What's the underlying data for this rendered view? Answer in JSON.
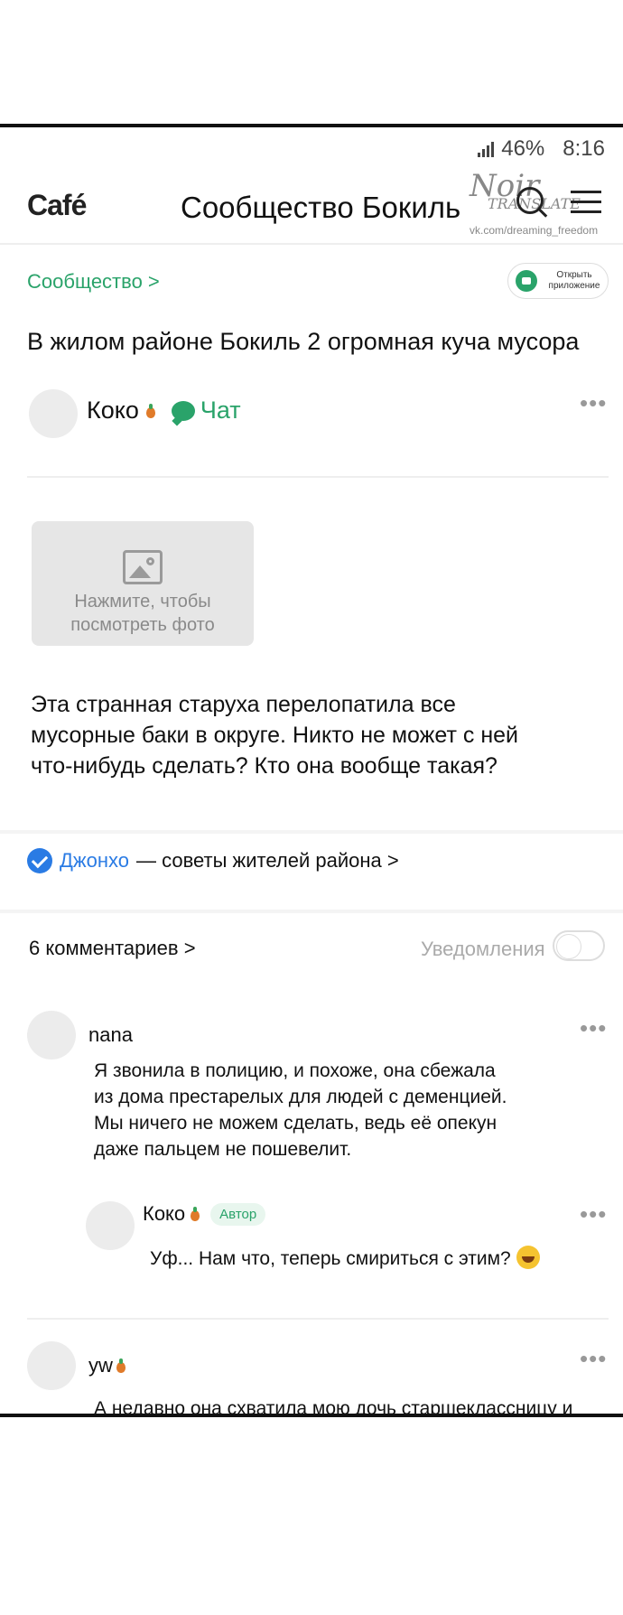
{
  "status": {
    "battery": "46%",
    "time": "8:16"
  },
  "header": {
    "logo": "Café",
    "title": "Сообщество Бокиль",
    "watermark_main": "Noir",
    "watermark_sub": "TRANSLATE",
    "watermark_url": "vk.com/dreaming_freedom"
  },
  "breadcrumb": "Сообщество >",
  "open_app": "Открыть приложение",
  "post": {
    "title": "В жилом районе Бокиль 2 огромная куча мусора",
    "author": "Коко",
    "chat_label": "Чат",
    "photo_caption": "Нажмите, чтобы посмотреть фото",
    "body_lines": [
      "Эта странная старуха перелопатила все",
      "мусорные баки в округе. Никто не может с ней",
      "что-нибудь сделать? Кто она вообще такая?"
    ]
  },
  "verified": {
    "name": "Джонхо",
    "suffix": "— советы жителей района >"
  },
  "comments_header": "6 комментариев >",
  "notifications_label": "Уведомления",
  "notifications_on": false,
  "comments": [
    {
      "name": "nana",
      "lines": [
        "Я звонила в полицию, и похоже, она сбежала",
        "из дома престарелых для людей с деменцией.",
        "Мы ничего не можем сделать, ведь её опекун",
        "даже пальцем не пошевелит."
      ]
    },
    {
      "name": "Коко",
      "badge": "Автор",
      "text": "Уф... Нам что, теперь смириться с этим?"
    },
    {
      "name": "yw",
      "text": "А недавно она схватила мою дочь старшеклассницу и"
    }
  ],
  "more_glyph": "•••"
}
